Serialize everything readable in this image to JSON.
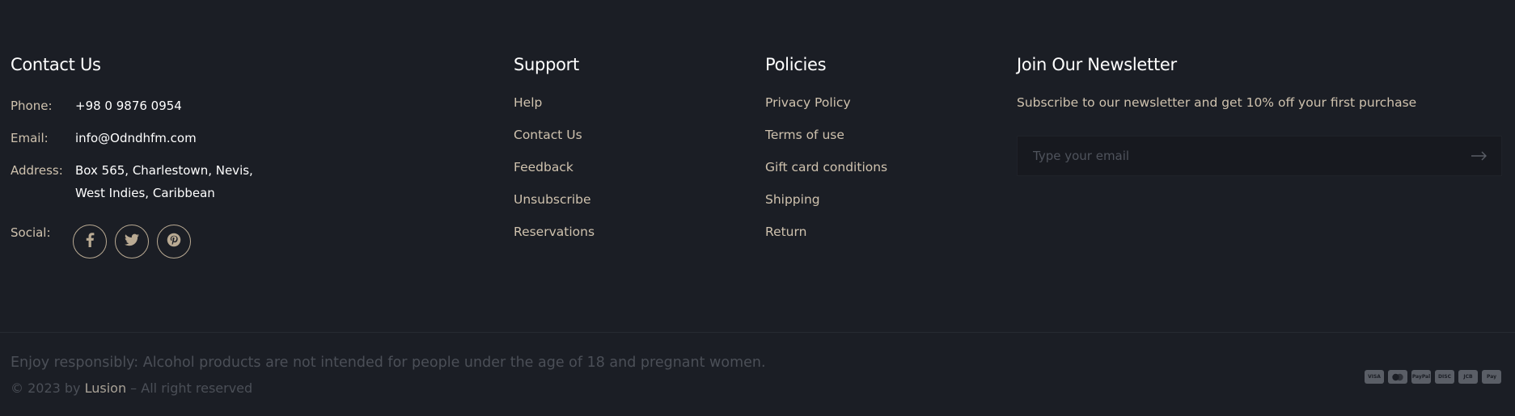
{
  "contact": {
    "heading": "Contact Us",
    "phone_label": "Phone:",
    "phone_value": "+98 0 9876 0954",
    "email_label": "Email:",
    "email_value": "info@Odndhfm.com",
    "address_label": "Address:",
    "address_line1": "Box 565, Charlestown, Nevis,",
    "address_line2": "West Indies, Caribbean",
    "social_label": "Social:",
    "social_icons": [
      "facebook-icon",
      "twitter-icon",
      "pinterest-icon"
    ]
  },
  "support": {
    "heading": "Support",
    "links": [
      "Help",
      "Contact Us",
      "Feedback",
      "Unsubscribe",
      "Reservations"
    ]
  },
  "policies": {
    "heading": "Policies",
    "links": [
      "Privacy Policy",
      "Terms of use",
      "Gift card conditions",
      "Shipping",
      "Return"
    ]
  },
  "newsletter": {
    "heading": "Join Our Newsletter",
    "text": "Subscribe to our newsletter and get 10% off your first purchase",
    "placeholder": "Type your email",
    "submit_icon": "arrow-right-icon"
  },
  "bottom": {
    "note": "Enjoy responsibly: Alcohol products are not intended for people under the age of 18 and pregnant women.",
    "copyright_prefix": "© 2023 by ",
    "copyright_brand": "Lusion",
    "copyright_suffix": " – All right reserved",
    "payment_methods": [
      "VISA",
      "MC",
      "PayPal",
      "DISC",
      "JCB",
      "Pay"
    ]
  },
  "colors": {
    "background": "#1b1e25",
    "heading": "#ffffff",
    "accent_text": "#cfc2ae",
    "muted_text": "#4b4f57"
  }
}
